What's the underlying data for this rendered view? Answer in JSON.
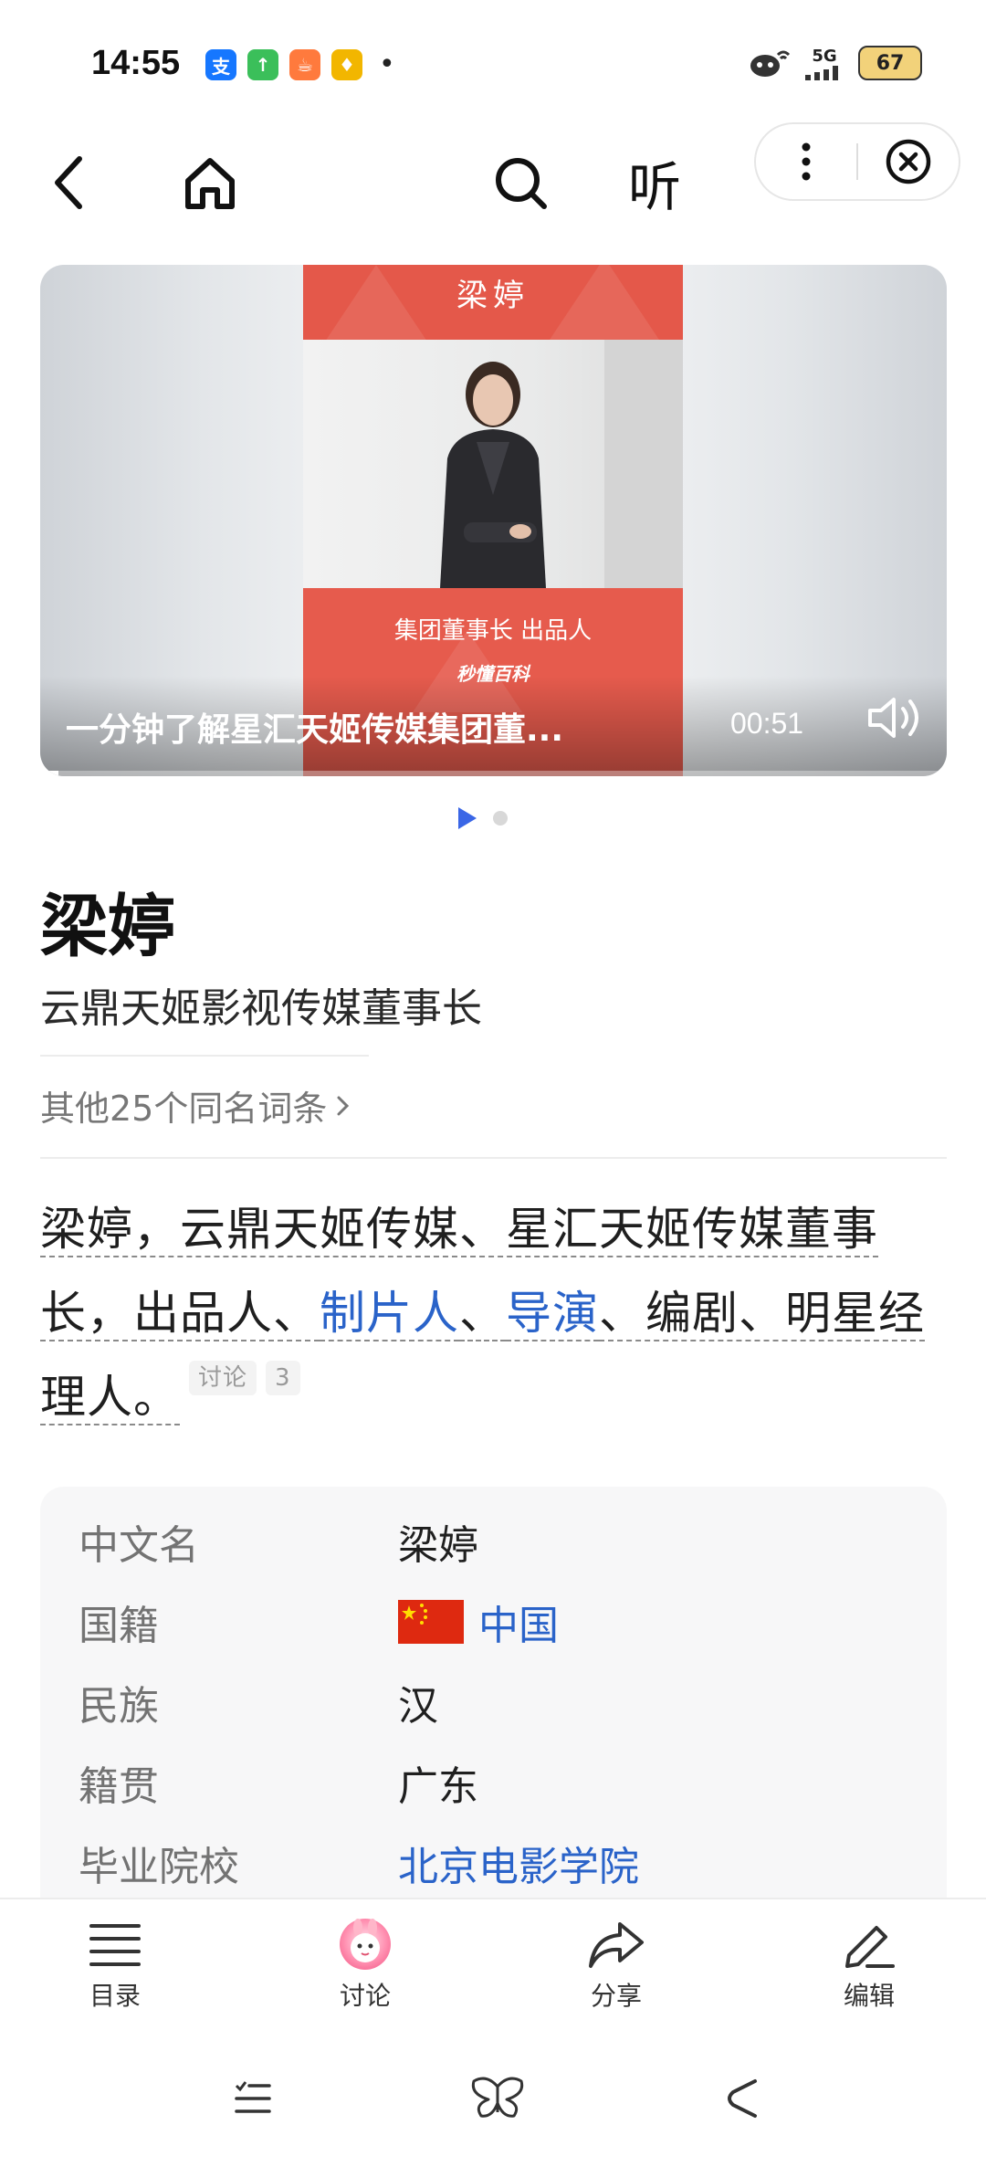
{
  "status_bar": {
    "time": "14:55",
    "apps": [
      {
        "name": "alipay-icon",
        "glyph": "支",
        "color": "#1677ff"
      },
      {
        "name": "upload-app-icon",
        "glyph": "↑",
        "color": "#3bbf5a"
      },
      {
        "name": "meal-app-icon",
        "glyph": "☕",
        "color": "#ff7a3d"
      },
      {
        "name": "diamond-app-icon",
        "glyph": "♦",
        "color": "#f2b600"
      }
    ],
    "more": "•",
    "signal_label": "5G",
    "battery": "67"
  },
  "nav": {
    "listen_label": "听"
  },
  "video": {
    "title": "一分钟了解星汇天姬传媒集团董...",
    "duration": "00:51",
    "progress": 0.02,
    "poster": {
      "name": "梁婷",
      "subtitle": "集团董事长 出品人",
      "brand": "秒懂百科"
    }
  },
  "carousel": {
    "count": 2,
    "active": 0
  },
  "entry": {
    "title": "梁婷",
    "subtitle": "云鼎天姬影视传媒董事长",
    "same_name": "其他25个同名词条",
    "summary": {
      "part1": "梁婷，云鼎天姬传媒、星汇天姬传媒董事长，出品人、",
      "link1": "制片人",
      "sep": "、",
      "link2": "导演",
      "part2": "、编剧、明星经理人。",
      "discuss_badge": "讨论",
      "discuss_count": "3"
    }
  },
  "info": {
    "rows": [
      {
        "label": "中文名",
        "value": "梁婷"
      },
      {
        "label": "国籍",
        "value": "中国"
      },
      {
        "label": "民族",
        "value": "汉"
      },
      {
        "label": "籍贯",
        "value": "广东"
      },
      {
        "label": "毕业院校",
        "value": "北京电影学院"
      }
    ]
  },
  "toolbar": {
    "catalog": "目录",
    "discuss": "讨论",
    "share": "分享",
    "edit": "编辑"
  },
  "colors": {
    "link": "#2a63c9",
    "accent": "#3a66e6",
    "poster_red": "#e65b4d"
  }
}
